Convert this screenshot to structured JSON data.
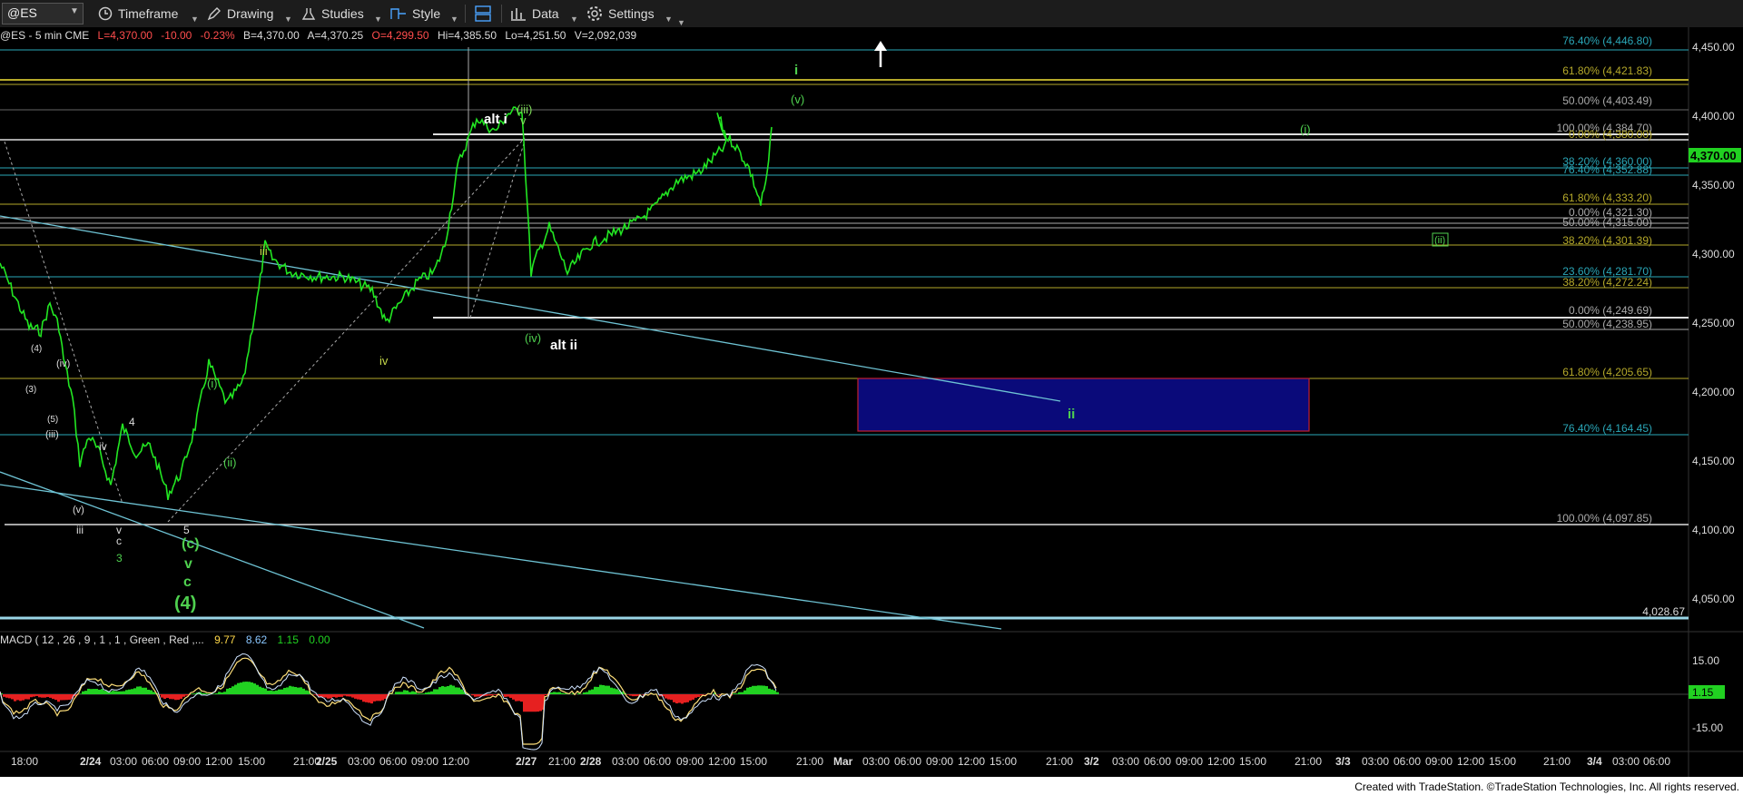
{
  "toolbar": {
    "symbol": "@ES",
    "timeframe_label": "Timeframe",
    "drawing_label": "Drawing",
    "studies_label": "Studies",
    "style_label": "Style",
    "data_label": "Data",
    "settings_label": "Settings"
  },
  "header": {
    "symbol_info": "@ES - 5 min  CME",
    "last": "L=4,370.00",
    "change": "-10.00",
    "change_pct": "-0.23%",
    "bid": "B=4,370.00",
    "ask": "A=4,370.25",
    "open": "O=4,299.50",
    "high": "Hi=4,385.50",
    "low": "Lo=4,251.50",
    "volume": "V=2,092,039"
  },
  "price_axis": {
    "ticks": [
      "4,450.00",
      "4,400.00",
      "4,350.00",
      "4,300.00",
      "4,250.00",
      "4,200.00",
      "4,150.00",
      "4,100.00",
      "4,050.00"
    ],
    "current_price": "4,370.00",
    "current_price_color": "#21d121",
    "level_4028": "4,028.67"
  },
  "fib_levels": [
    {
      "label": "76.40% (4,446.80)",
      "color": "#2aa7b8"
    },
    {
      "label": "61.80% (4,421.83)",
      "color": "#b5a92a"
    },
    {
      "label": "50.00% (4,403.49)",
      "color": "#aaaaaa"
    },
    {
      "label": "100.00% (4,384.70)",
      "color": "#aaaaaa"
    },
    {
      "label": "0.00% (4,380.00)",
      "color": "#b5a92a"
    },
    {
      "label": "38.20% (4,360.00)",
      "color": "#2aa7b8"
    },
    {
      "label": "76.40% (4,352.88)",
      "color": "#2aa7b8"
    },
    {
      "label": "61.80% (4,333.20)",
      "color": "#b5a92a"
    },
    {
      "label": "0.00% (4,321.30)",
      "color": "#aaaaaa"
    },
    {
      "label": "50.00% (4,315.00)",
      "color": "#aaaaaa"
    },
    {
      "label": "38.20% (4,301.39)",
      "color": "#b5a92a"
    },
    {
      "label": "23.60% (4,281.70)",
      "color": "#2aa7b8"
    },
    {
      "label": "38.20% (4,272.24)",
      "color": "#b5a92a"
    },
    {
      "label": "0.00% (4,249.69)",
      "color": "#aaaaaa"
    },
    {
      "label": "50.00% (4,238.95)",
      "color": "#aaaaaa"
    },
    {
      "label": "61.80% (4,205.65)",
      "color": "#b5a92a"
    },
    {
      "label": "76.40% (4,164.45)",
      "color": "#2aa7b8"
    },
    {
      "label": "100.00% (4,097.85)",
      "color": "#aaaaaa"
    }
  ],
  "wave_labels": {
    "alt_i": "alt i",
    "alt_ii": "alt ii",
    "iii_top": "(iii)",
    "v_small": "v",
    "i_green": "i",
    "v_paren": "(v)",
    "i_paren": "(i)",
    "ii_box": "(ii)",
    "ii_target": "ii",
    "iv_paren": "(iv)",
    "iii_green": "iii",
    "iv_green": "iv",
    "i_paren_low": "(i)",
    "ii_paren_low": "(ii)",
    "c_paren": "(c)",
    "v_big": "v",
    "c_big": "c",
    "four_paren": "(4)",
    "five": "5",
    "four_w": "4",
    "iv_w": "iv",
    "v_w": "v",
    "c_w": "c",
    "three_g": "3",
    "iii_w": "iii",
    "v_paren_w": "(v)",
    "iii_paren_w": "(iii)",
    "five_paren_w": "(5)",
    "iv_paren_w": "(iv)",
    "three_paren_w": "(3)",
    "four_paren_w": "(4)"
  },
  "macd": {
    "label": "MACD ( 12 , 26 , 9 , 1 , 1 , Green , Red ,...",
    "v1": "9.77",
    "v2": "8.62",
    "v3": "1.15",
    "v4": "0.00",
    "ticks": [
      "15.00",
      "1.15",
      "-15.00"
    ]
  },
  "time_axis": {
    "labels": [
      "18:00",
      "2/24",
      "03:00",
      "06:00",
      "09:00",
      "12:00",
      "15:00",
      "21:00",
      "2/25",
      "03:00",
      "06:00",
      "09:00",
      "12:00",
      "2/27",
      "21:00",
      "2/28",
      "03:00",
      "06:00",
      "09:00",
      "12:00",
      "15:00",
      "21:00",
      "Mar",
      "03:00",
      "06:00",
      "09:00",
      "12:00",
      "15:00",
      "21:00",
      "3/2",
      "03:00",
      "06:00",
      "09:00",
      "12:00",
      "15:00",
      "21:00",
      "3/3",
      "03:00",
      "06:00",
      "09:00",
      "12:00",
      "15:00",
      "21:00",
      "3/4",
      "03:00",
      "06:00"
    ]
  },
  "footer": {
    "credit": "Created with TradeStation. ©TradeStation Technologies, Inc. All rights reserved."
  }
}
